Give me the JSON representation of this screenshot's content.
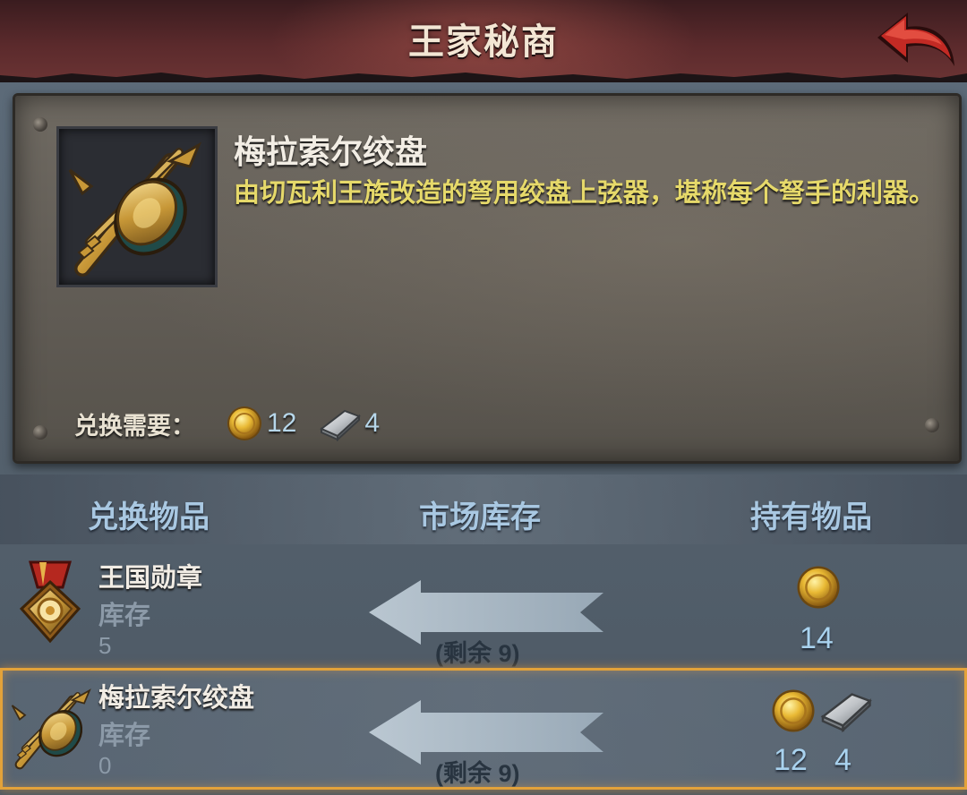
{
  "header": {
    "title": "王家秘商"
  },
  "detail": {
    "name": "梅拉索尔绞盘",
    "description": "由切瓦利王族改造的弩用绞盘上弦器，堪称每个弩手的利器。",
    "cost_label": "兑换需要：",
    "cost": {
      "gold": "12",
      "silver": "4"
    }
  },
  "columns": {
    "item": "兑换物品",
    "market": "市场库存",
    "owned": "持有物品"
  },
  "rows": [
    {
      "name": "王国勋章",
      "stock_label": "库存",
      "stock": "5",
      "remaining": "(剩余 9)",
      "owned_gold": "14",
      "selected": false
    },
    {
      "name": "梅拉索尔绞盘",
      "stock_label": "库存",
      "stock": "0",
      "remaining": "(剩余 9)",
      "owned_gold": "12",
      "owned_silver": "4",
      "selected": true
    }
  ],
  "colors": {
    "highlight": "#e3a23a",
    "desc_text": "#e6d96a",
    "column_text": "#a9c8e2"
  }
}
